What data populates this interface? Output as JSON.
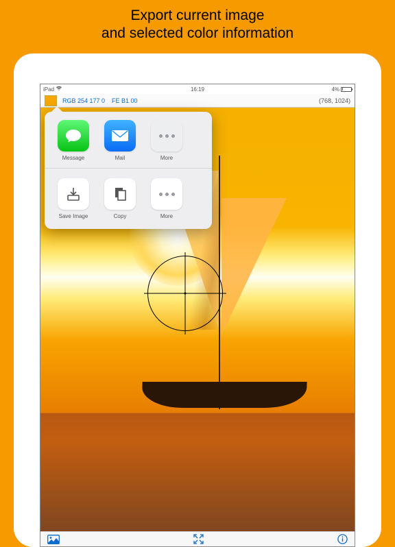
{
  "caption_line1": "Export current image",
  "caption_line2": "and selected color information",
  "status": {
    "carrier": "iPad",
    "time": "16:19",
    "battery_pct": "4%"
  },
  "info": {
    "swatch_hex": "#f6a703",
    "rgb_label": "RGB  254  177  0",
    "hex_label": "FE B1 00",
    "dimensions": "(768, 1024)"
  },
  "share": {
    "row1": [
      {
        "label": "Message"
      },
      {
        "label": "Mail"
      },
      {
        "label": "More"
      }
    ],
    "row2": [
      {
        "label": "Save Image"
      },
      {
        "label": "Copy"
      },
      {
        "label": "More"
      }
    ]
  }
}
